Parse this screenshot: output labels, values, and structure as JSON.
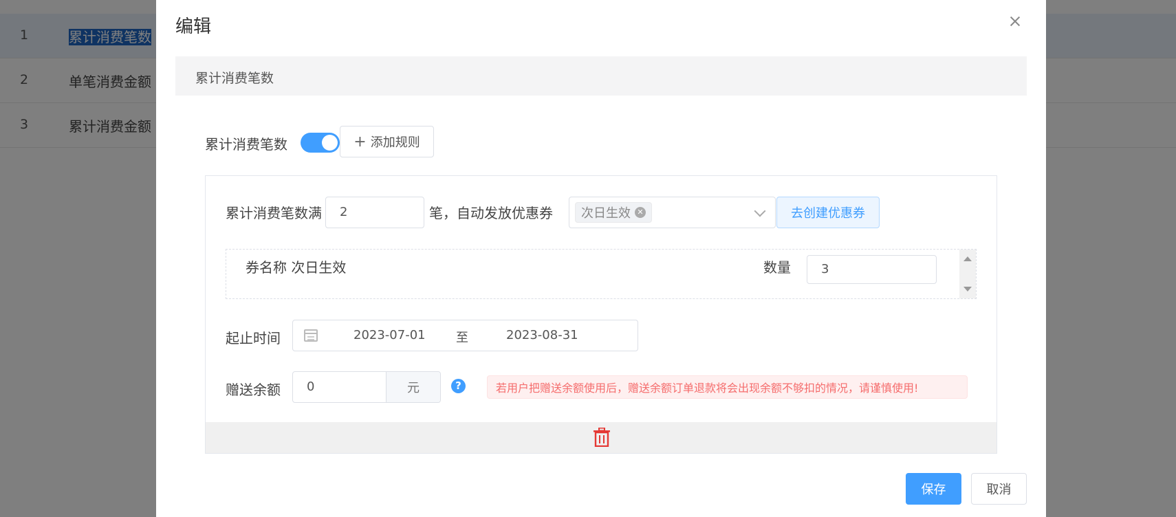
{
  "background_table": {
    "rows": [
      {
        "index": "1",
        "name": "累计消费笔数"
      },
      {
        "index": "2",
        "name": "单笔消费金额"
      },
      {
        "index": "3",
        "name": "累计消费金额"
      }
    ]
  },
  "modal": {
    "title": "编辑",
    "section_title": "累计消费笔数",
    "rule_type_label": "累计消费笔数",
    "switch_on": true,
    "add_rule_label": "添加规则",
    "rule": {
      "count_prefix": "累计消费笔数满",
      "count_value": "2",
      "count_suffix": "笔，自动发放优惠券",
      "selected_coupon_tag": "次日生效",
      "create_coupon_label": "去创建优惠券",
      "coupon_name_label": "券名称",
      "coupon_name_value": "次日生效",
      "quantity_label": "数量",
      "quantity_value": "3",
      "date_label": "起止时间",
      "start_date": "2023-07-01",
      "date_separator": "至",
      "end_date": "2023-08-31",
      "gift_label": "赠送余额",
      "gift_value": "0",
      "gift_unit": "元",
      "help_glyph": "?",
      "warning_text": "若用户把赠送余额使用后，赠送余额订单退款将会出现余额不够扣的情况，请谨慎使用!"
    },
    "save_label": "保存",
    "cancel_label": "取消"
  },
  "colors": {
    "primary": "#409eff",
    "danger": "#f56c6c",
    "trash": "#e53935"
  },
  "icons": [
    "close-icon",
    "plus-icon",
    "tag-close-icon",
    "chevron-down-icon",
    "calendar-icon",
    "question-icon",
    "trash-icon"
  ]
}
